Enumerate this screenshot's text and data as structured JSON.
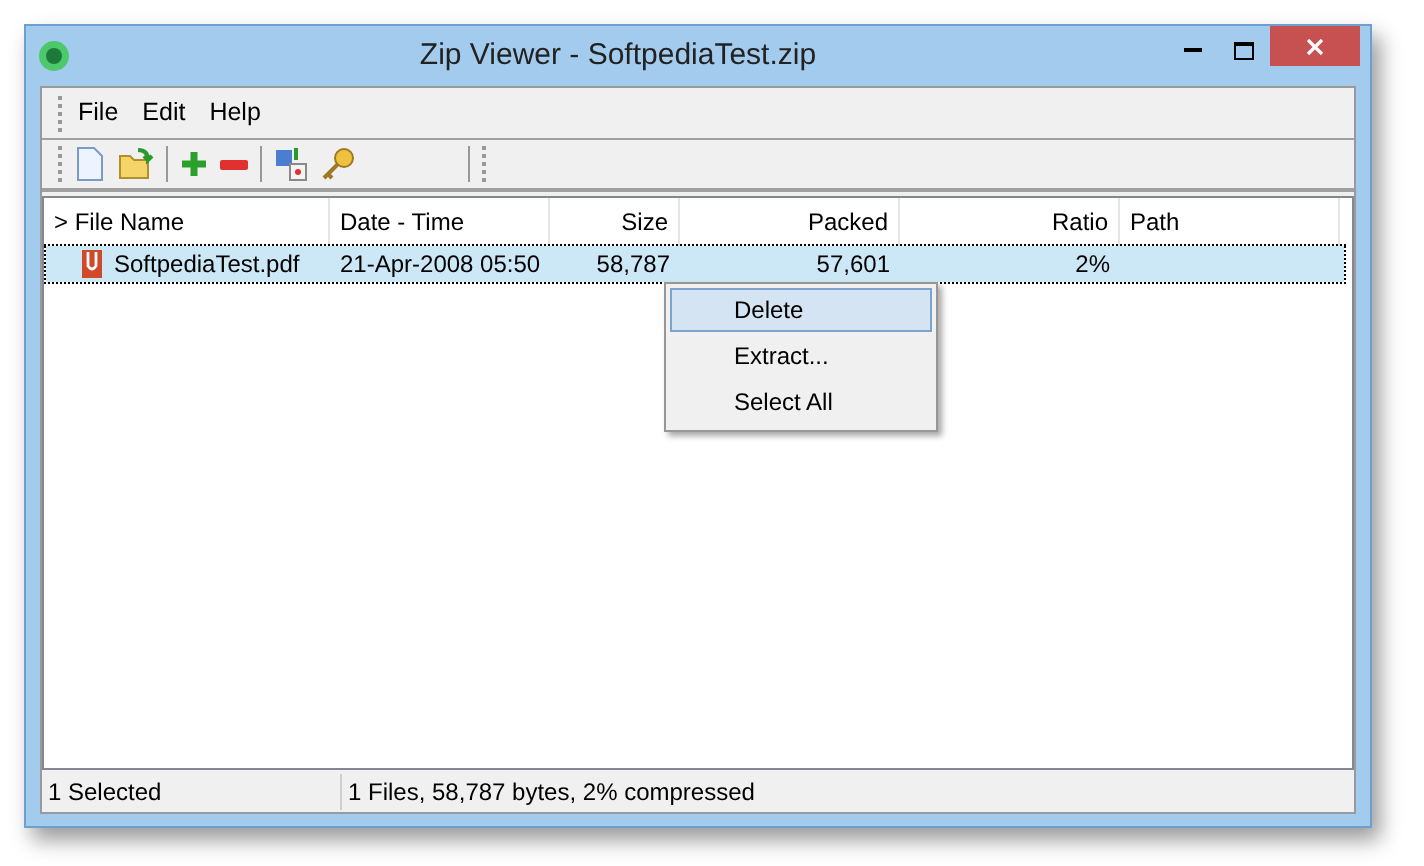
{
  "window": {
    "title": "Zip Viewer - SoftpediaTest.zip"
  },
  "menu": [
    "File",
    "Edit",
    "Help"
  ],
  "table": {
    "columns": [
      "> File Name",
      "Date - Time",
      "Size",
      "Packed",
      "Ratio",
      "Path"
    ],
    "rows": [
      {
        "selected": true,
        "cells": [
          "SoftpediaTest.pdf",
          "21-Apr-2008 05:50",
          "58,787",
          "57,601",
          "2%",
          ""
        ]
      }
    ]
  },
  "context_menu": [
    {
      "label": "Delete",
      "selected": true
    },
    {
      "label": "Extract...",
      "selected": false
    },
    {
      "label": "Select All",
      "selected": false
    }
  ],
  "status_bar": [
    "1 Selected",
    "1 Files, 58,787 bytes, 2% compressed"
  ]
}
